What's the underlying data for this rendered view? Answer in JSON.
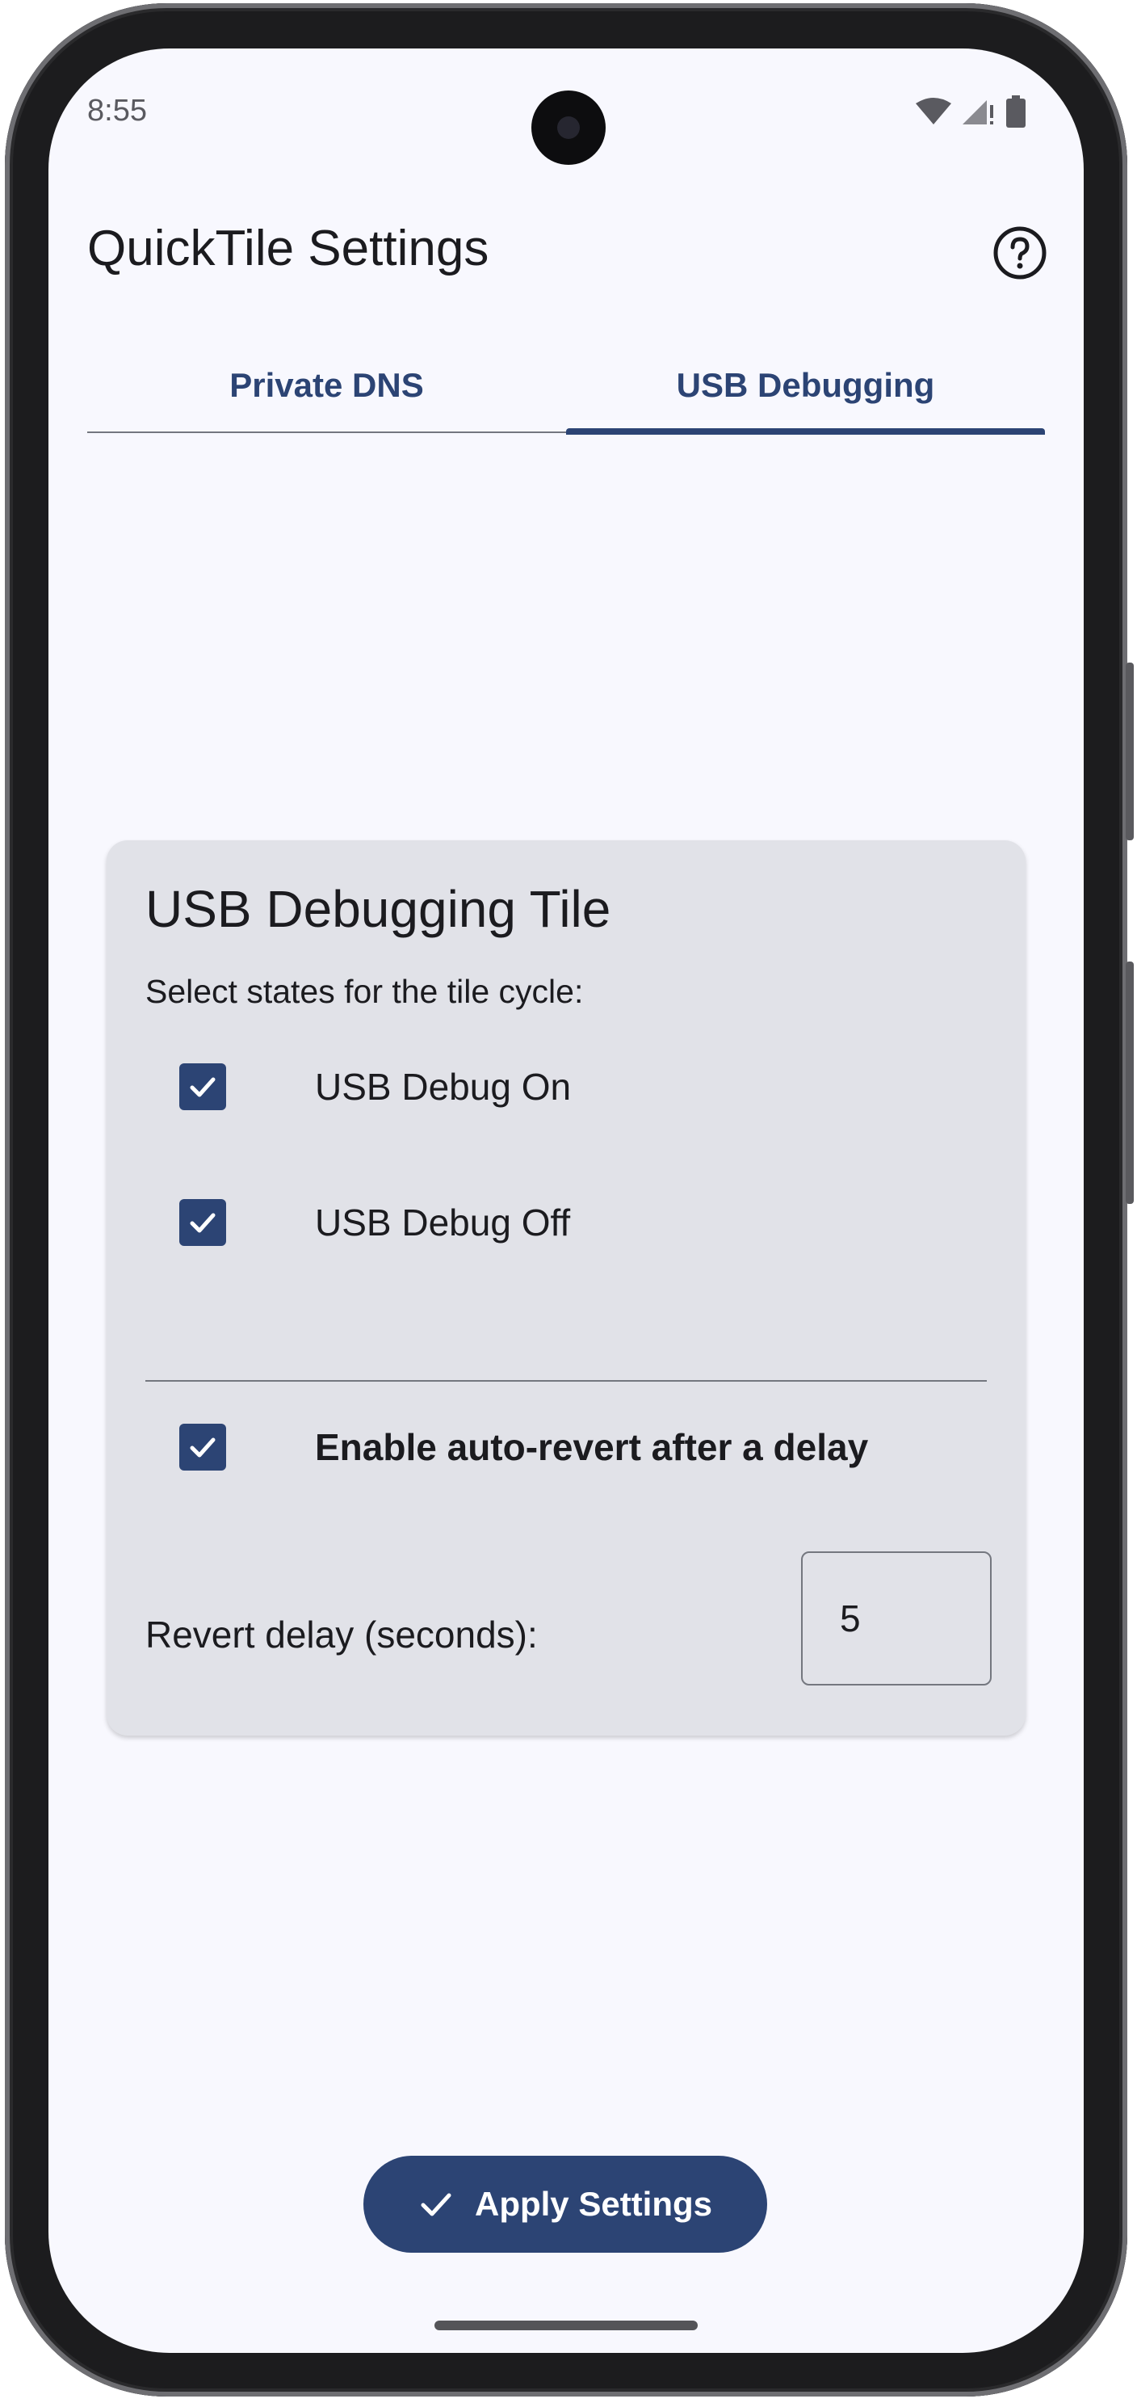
{
  "status_bar": {
    "time": "8:55"
  },
  "header": {
    "title": "QuickTile Settings",
    "help_icon": "help-circle-icon"
  },
  "tabs": [
    {
      "label": "Private DNS",
      "active": false
    },
    {
      "label": "USB Debugging",
      "active": true
    }
  ],
  "card": {
    "title": "USB Debugging Tile",
    "subtitle": "Select states for the tile cycle:",
    "states": [
      {
        "label": "USB Debug On",
        "checked": true
      },
      {
        "label": "USB Debug Off",
        "checked": true
      }
    ],
    "auto_revert": {
      "label": "Enable auto-revert after a delay",
      "checked": true
    },
    "delay": {
      "label": "Revert delay (seconds):",
      "value": "5"
    }
  },
  "apply_button": {
    "label": "Apply Settings",
    "icon": "check-icon"
  },
  "colors": {
    "accent": "#2c4474",
    "card": "#e1e2e8",
    "background": "#f8f8fe"
  }
}
